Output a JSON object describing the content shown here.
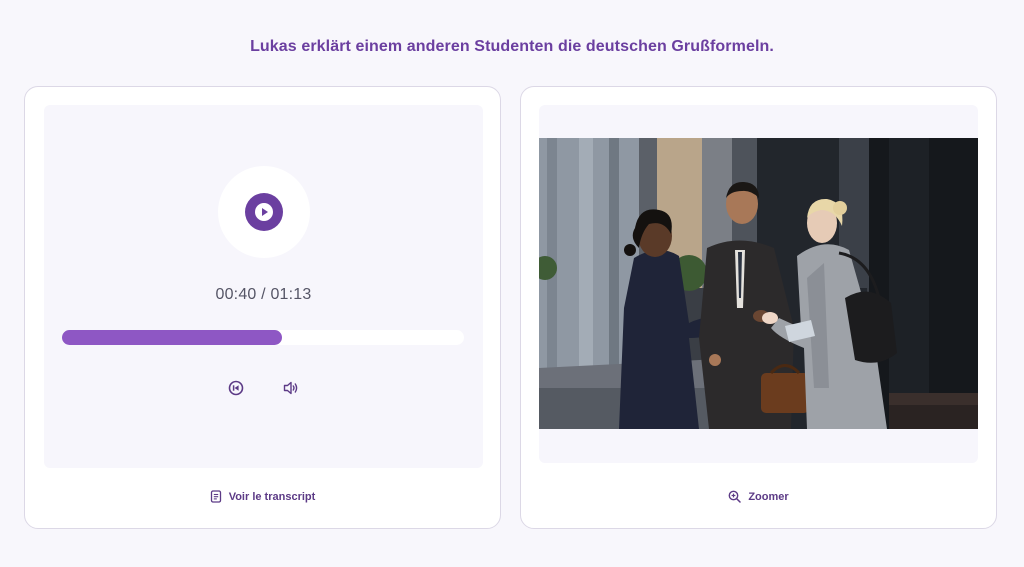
{
  "title": "Lukas erklärt einem anderen Studenten die deutschen Grußformeln.",
  "audio": {
    "current_time": "00:40",
    "duration": "01:13",
    "time_display": "00:40 / 01:13",
    "progress_fraction": 0.548,
    "play_icon": "play-icon",
    "rewind_icon": "rewind-icon",
    "volume_icon": "volume-icon"
  },
  "transcript_link": "Voir le transcript",
  "zoom_link": "Zoomer",
  "colors": {
    "accent": "#6b3fa0",
    "progress": "#8e57c4",
    "background": "#f8f7fc",
    "panel": "#f7f6fc"
  }
}
